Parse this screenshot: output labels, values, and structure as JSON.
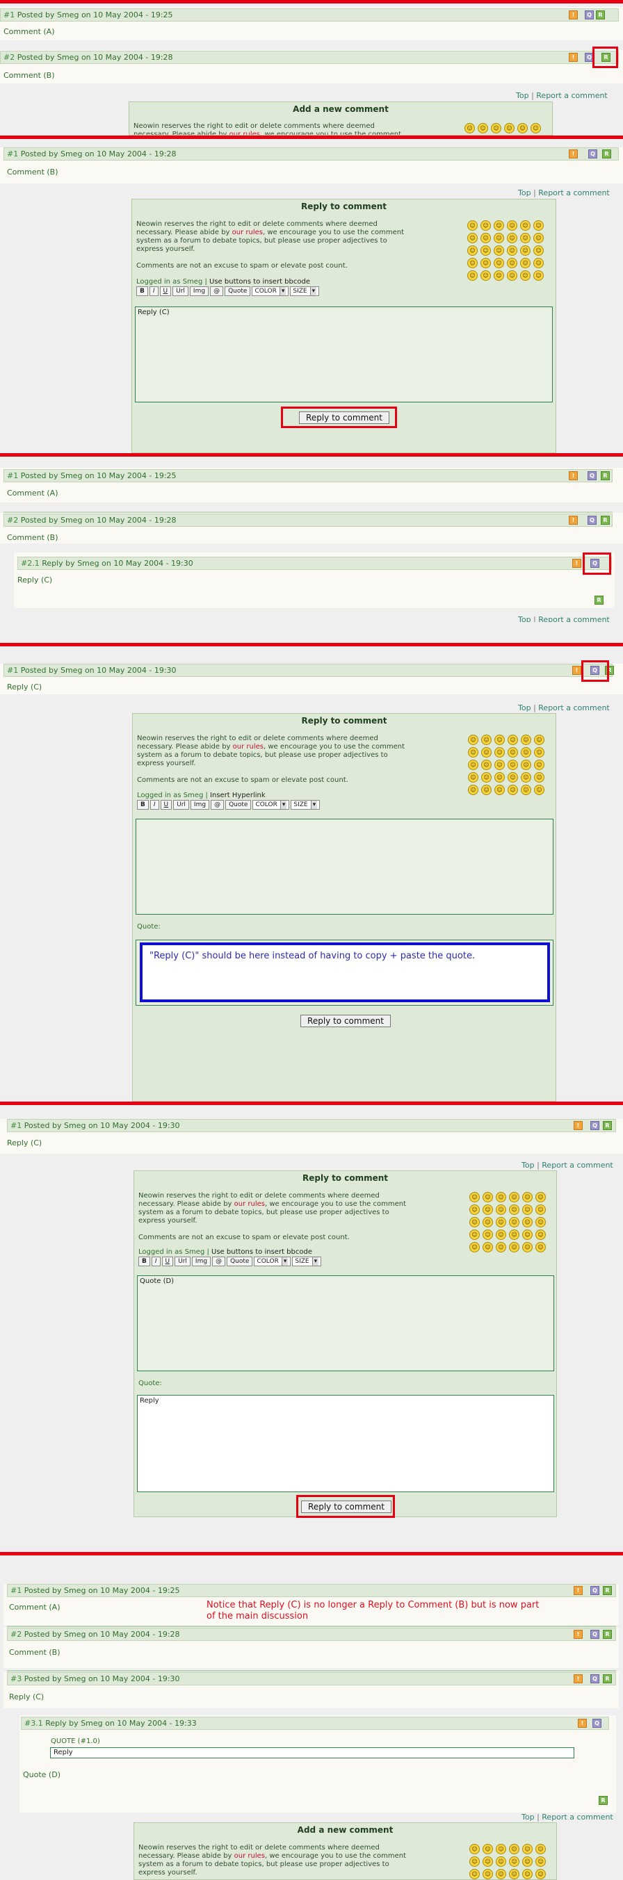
{
  "header_prefix": "Posted by",
  "date_word": "on",
  "reply_word": "Reply by",
  "icons": {
    "report": "report-icon",
    "quote": "quote-icon",
    "reply": "reply-icon"
  },
  "links": {
    "top": "Top",
    "separator": "|",
    "report": "Report a comment"
  },
  "form": {
    "add_title": "Add a new comment",
    "reply_title": "Reply to comment",
    "note_before": "Neowin reserves the right to edit or delete comments where deemed necessary. Please abide by",
    "rules_link": "our rules",
    "note_after": ", we encourage you to use the comment system as a forum to debate topics, but please use proper adjectives to express yourself.",
    "spam_note": "Comments are not an excuse to spam or elevate post count.",
    "logged_in": "Logged in as Smeg",
    "hint_bbcode": "Use buttons to insert bbcode",
    "hint_hyperlink": "Insert Hyperlink",
    "buttons": [
      "B",
      "I",
      "U",
      "Url",
      "Img",
      "@",
      "Quote"
    ],
    "color_select": "COLOR",
    "size_select": "SIZE",
    "quote_label": "Quote:",
    "submit_label": "Reply to comment"
  },
  "panel1": {
    "c1": {
      "num": "#1",
      "author": "Smeg",
      "date": "10 May 2004 - 19:25",
      "text": "Comment (A)"
    },
    "c2": {
      "num": "#2",
      "author": "Smeg",
      "date": "10 May 2004 - 19:28",
      "text": "Comment (B)"
    }
  },
  "panel2": {
    "c1": {
      "num": "#1",
      "author": "Smeg",
      "date": "10 May 2004 - 19:28",
      "text": "Comment (B)"
    },
    "textarea": "Reply (C)"
  },
  "panel3": {
    "c1": {
      "num": "#1",
      "author": "Smeg",
      "date": "10 May 2004 - 19:25",
      "text": "Comment (A)"
    },
    "c2": {
      "num": "#2",
      "author": "Smeg",
      "date": "10 May 2004 - 19:28",
      "text": "Comment (B)"
    },
    "r1": {
      "num": "#2.1",
      "author": "Smeg",
      "date": "10 May 2004 - 19:30",
      "text": "Reply (C)"
    }
  },
  "panel4": {
    "c1": {
      "num": "#1",
      "author": "Smeg",
      "date": "10 May 2004 - 19:30",
      "text": "Reply (C)"
    },
    "callout": "\"Reply (C)\" should be here instead of having to copy + paste the quote."
  },
  "panel5": {
    "c1": {
      "num": "#1",
      "author": "Smeg",
      "date": "10 May 2004 - 19:30",
      "text": "Reply (C)"
    },
    "textarea": "Quote (D)",
    "quote_textarea": "Reply"
  },
  "panel6": {
    "c1": {
      "num": "#1",
      "author": "Smeg",
      "date": "10 May 2004 - 19:25",
      "text": "Comment (A)"
    },
    "c2": {
      "num": "#2",
      "author": "Smeg",
      "date": "10 May 2004 - 19:28",
      "text": "Comment (B)"
    },
    "c3": {
      "num": "#3",
      "author": "Smeg",
      "date": "10 May 2004 - 19:30",
      "text": "Reply (C)"
    },
    "r1": {
      "num": "#3.1",
      "author": "Smeg",
      "date": "10 May 2004 - 19:33",
      "quote_header": "QUOTE (#1.0)",
      "quote_text": "Reply",
      "text": "Quote (D)"
    },
    "notice": "Notice that Reply (C) is no longer a Reply to Comment (B) but is now part of the main discussion"
  },
  "colors": {
    "accent_red": "#e60012",
    "header_bg": "#dfe9d7",
    "link_green": "#2f6f2f",
    "callout_blue": "#1010d0"
  }
}
